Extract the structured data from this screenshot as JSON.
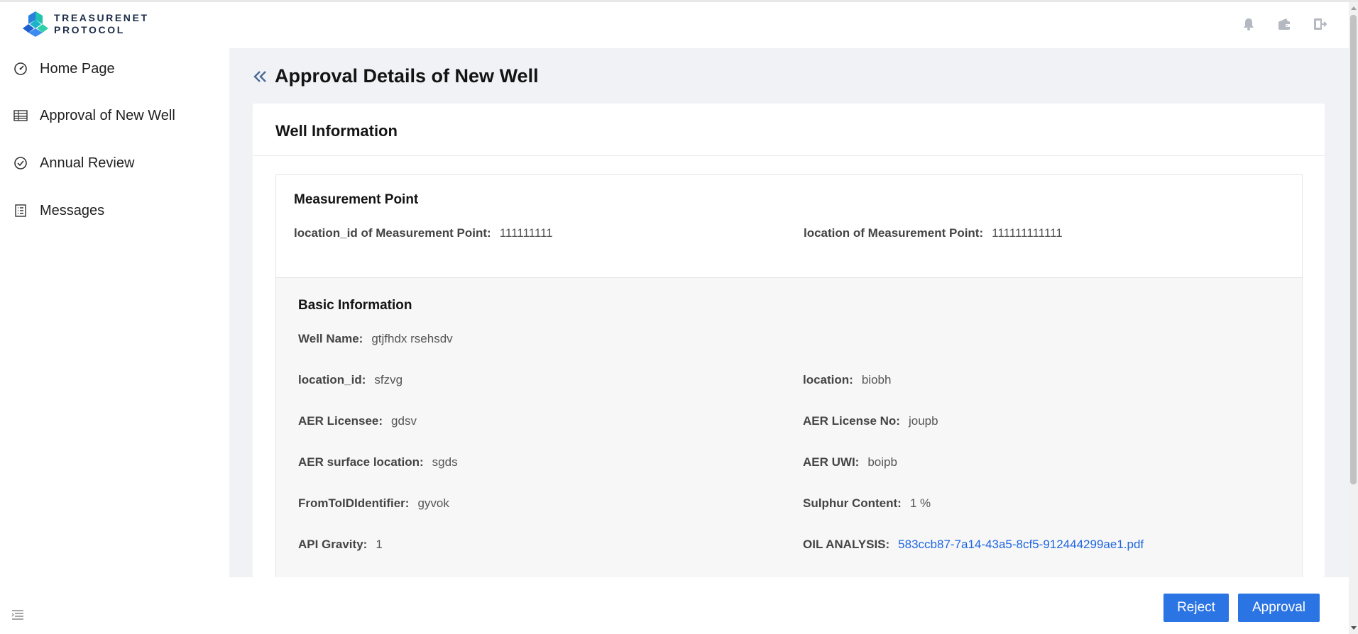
{
  "brand": {
    "line1": "TREASURENET",
    "line2": "PROTOCOL",
    "logo_icon": "treasurenet-logo-icon",
    "colors": {
      "teal": "#21c2b0",
      "blue": "#2a7fe0",
      "navy": "#1b2b47"
    }
  },
  "header": {
    "icons": [
      "bell-icon",
      "wallet-icon",
      "logout-icon"
    ]
  },
  "sidebar": {
    "items": [
      {
        "label": "Home Page",
        "icon": "dashboard-gauge-icon"
      },
      {
        "label": "Approval of New Well",
        "icon": "table-icon"
      },
      {
        "label": "Annual Review",
        "icon": "check-circle-icon"
      },
      {
        "label": "Messages",
        "icon": "list-document-icon"
      }
    ],
    "collapse_icon": "menu-collapse-icon"
  },
  "page": {
    "title": "Approval Details of New Well",
    "back_icon": "double-chevron-left-icon"
  },
  "card": {
    "title": "Well Information"
  },
  "measurement_point": {
    "title": "Measurement Point",
    "location_id_label": "location_id of Measurement Point:",
    "location_id_value": "111111111",
    "location_label": "location of Measurement Point:",
    "location_value": "111111111111"
  },
  "basic_info": {
    "title": "Basic Information",
    "well_name_label": "Well Name:",
    "well_name_value": "gtjfhdx rsehsdv",
    "location_id_label": "location_id:",
    "location_id_value": "sfzvg",
    "location_label": "location:",
    "location_value": "biobh",
    "aer_licensee_label": "AER Licensee:",
    "aer_licensee_value": "gdsv",
    "aer_license_no_label": "AER License No:",
    "aer_license_no_value": "joupb",
    "aer_surface_location_label": "AER surface location:",
    "aer_surface_location_value": "sgds",
    "aer_uwi_label": "AER UWI:",
    "aer_uwi_value": "boipb",
    "from_to_id_label": "FromToIDIdentifier:",
    "from_to_id_value": "gyvok",
    "sulphur_label": "Sulphur Content:",
    "sulphur_value": "1 %",
    "api_gravity_label": "API Gravity:",
    "api_gravity_value": "1",
    "oil_analysis_label": "OIL ANALYSIS:",
    "oil_analysis_value": "583ccb87-7a14-43a5-8cf5-912444299ae1.pdf"
  },
  "footer": {
    "reject_label": "Reject",
    "approve_label": "Approval",
    "button_color": "#2b74e3"
  }
}
